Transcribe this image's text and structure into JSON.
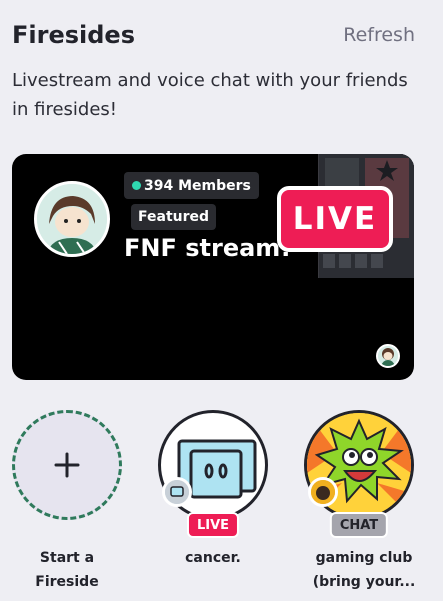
{
  "header": {
    "title": "Firesides",
    "refresh_label": "Refresh"
  },
  "description": "Livestream and voice chat with your friends in firesides!",
  "featured": {
    "members_label": "394 Members",
    "featured_label": "Featured",
    "stream_name": "FNF stream!",
    "live_label": "LIVE",
    "accent": "#ee1d55",
    "member_dot_color": "#2fd8b0"
  },
  "tiles": [
    {
      "label": "Start a Fireside",
      "icon": "plus-icon"
    },
    {
      "label": "cancer.",
      "status": "LIVE"
    },
    {
      "label": "gaming club (bring your...",
      "status": "CHAT"
    }
  ]
}
